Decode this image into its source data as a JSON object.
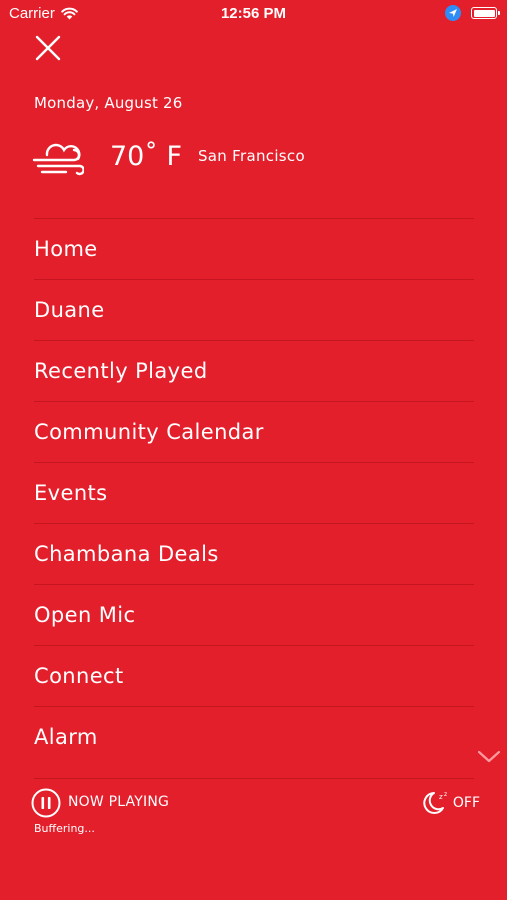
{
  "status_bar": {
    "carrier": "Carrier",
    "time": "12:56 PM",
    "icons": [
      "wifi-icon",
      "location-arrow-icon",
      "battery-icon"
    ]
  },
  "header": {
    "close_icon": "close-icon",
    "date": "Monday, August 26"
  },
  "weather": {
    "icon": "cloud-wind-icon",
    "temperature": "70˚ F",
    "city": "San Francisco"
  },
  "menu": {
    "items": [
      {
        "label": "Home"
      },
      {
        "label": "Duane"
      },
      {
        "label": "Recently Played"
      },
      {
        "label": "Community Calendar"
      },
      {
        "label": "Events"
      },
      {
        "label": "Chambana Deals"
      },
      {
        "label": "Open Mic"
      },
      {
        "label": "Connect"
      },
      {
        "label": "Alarm"
      }
    ],
    "scroll_icon": "chevron-down-icon"
  },
  "player": {
    "control_icon": "pause-icon",
    "label": "NOW PLAYING",
    "status": "Buffering...",
    "sleep_timer": {
      "icon": "moon-zzz-icon",
      "label": "OFF"
    }
  },
  "colors": {
    "background": "#E41F2C",
    "text": "#FFFFFF",
    "accent": "#FF9A9F"
  }
}
